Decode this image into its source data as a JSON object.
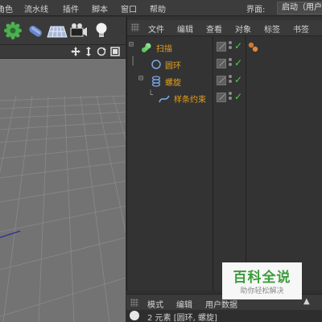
{
  "menubar": {
    "items": [
      "角色",
      "流水线",
      "插件",
      "脚本",
      "窗口",
      "帮助"
    ],
    "interface_label": "界面:",
    "layout_value": "启动（用户"
  },
  "toolbar": {
    "tools": [
      "gear-icon",
      "capsule-icon",
      "floor-grid-icon",
      "camera-icon",
      "light-bulb-icon"
    ]
  },
  "viewport": {
    "nav_controls": [
      "move-view-icon",
      "dolly-view-icon",
      "rotate-view-icon",
      "maximize-view-icon"
    ]
  },
  "object_manager": {
    "menu": [
      "文件",
      "编辑",
      "查看",
      "对象",
      "标签",
      "书签"
    ],
    "objects": [
      {
        "name": "扫描",
        "color": "#e0a020",
        "icon": "sweep-icon",
        "tree": "⊟"
      },
      {
        "name": "圆环",
        "color": "#e0a020",
        "icon": "circle-spline-icon",
        "tree": ""
      },
      {
        "name": "螺旋",
        "color": "#e0a020",
        "icon": "helix-spline-icon",
        "tree": "⊟"
      },
      {
        "name": "样条约束",
        "color": "#e0a020",
        "icon": "spline-constraint-icon",
        "tree": ""
      }
    ]
  },
  "attribute_manager": {
    "menu": [
      "模式",
      "编辑",
      "用户数据"
    ],
    "info": "2 元素 [圆环, 螺旋]"
  },
  "watermark": {
    "title": "百科全说",
    "subtitle": "助你轻松解决"
  },
  "colors": {
    "accent_orange": "#e0a020",
    "check_green": "#48d048",
    "viewport_gray": "#737373"
  }
}
